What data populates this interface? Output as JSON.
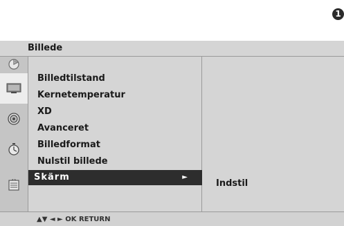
{
  "step_badge": "1",
  "osd": {
    "title": "Billede",
    "icons": [
      "picture-icon",
      "screen-icon",
      "audio-icon",
      "timer-icon",
      "option-icon"
    ],
    "menu_items": [
      {
        "label": "Billedtilstand"
      },
      {
        "label": "Kernetemperatur"
      },
      {
        "label": "XD"
      },
      {
        "label": "Avanceret"
      },
      {
        "label": "Billedformat"
      },
      {
        "label": "Nulstil billede"
      },
      {
        "label": "Skärm",
        "selected": true,
        "arrow": "►"
      }
    ],
    "submenu_value": "Indstil",
    "footer_hint": "▲▼  ◄ ►  OK  RETURN"
  }
}
